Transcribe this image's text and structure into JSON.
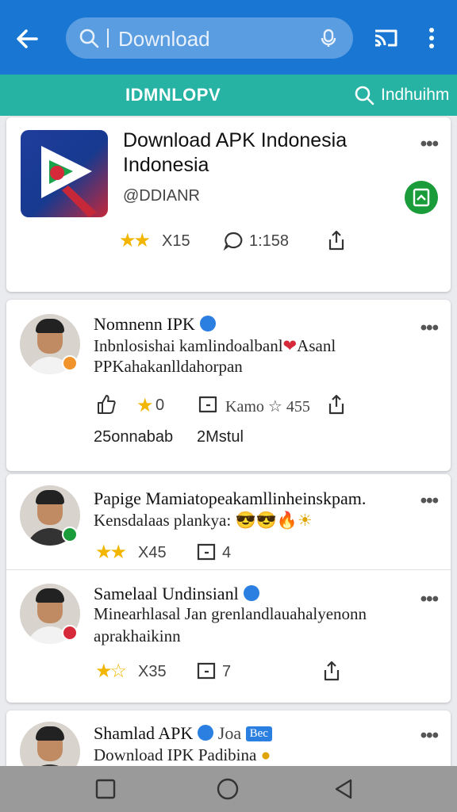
{
  "topbar": {
    "back_icon": "arrow-left-icon",
    "search_text": "Download",
    "search_icon": "search-icon",
    "mic_icon": "mic-icon",
    "cast_icon": "cast-icon",
    "more_icon": "more-vertical-icon"
  },
  "tabbar": {
    "title": "IDMNLOPV",
    "search_label": "Indhuihm"
  },
  "app_card": {
    "title_line1": "Download APK Indonesia",
    "title_line2": "Indonesia",
    "developer": "@DDIANR",
    "rating_stars": 2,
    "rating_value": "X15",
    "comments": "1:158",
    "more": "•••"
  },
  "posts": [
    {
      "author": "Nomnenn IPK",
      "verified": true,
      "line1": "Inbnlosishai kamlindoalbanl",
      "line1_tail": "Asanl",
      "line2": "PPKahakanlldahorpan",
      "like_icon": "thumbs-up-icon",
      "stars_text": "0",
      "comment_text": "Kamo",
      "star_count": "455",
      "stat1": "25onnabab",
      "stat2": "2Mstul",
      "more": "•••"
    },
    {
      "author": "Papige Mamiatopeakamllinheinskpam.",
      "line1": "Kensdalaas plankya:",
      "emoji": "😎😎🔥☀",
      "rating_value": "X45",
      "comment_count": "4",
      "more": "•••"
    },
    {
      "author": "Samelaal Undinsianl",
      "verified": true,
      "line1": "Minearhlasal Jan grenlandlauahalyenonn",
      "line2": "aprakhaikinn",
      "rating_value": "X35",
      "comment_count": "7",
      "more": "•••"
    },
    {
      "author": "Shamlad APK",
      "verified": true,
      "author_tail": "Joa",
      "tag": "Bec",
      "line1": "Download IPK Padibina",
      "more": "•••"
    }
  ],
  "navbar": {
    "recents_icon": "square-icon",
    "home_icon": "circle-icon",
    "back_icon": "triangle-back-icon"
  },
  "colors": {
    "topbar": "#1976d2",
    "tabbar": "#26b3a3",
    "star": "#f2b600",
    "verified": "#2b7fe0",
    "download_green": "#1b9c3a"
  }
}
